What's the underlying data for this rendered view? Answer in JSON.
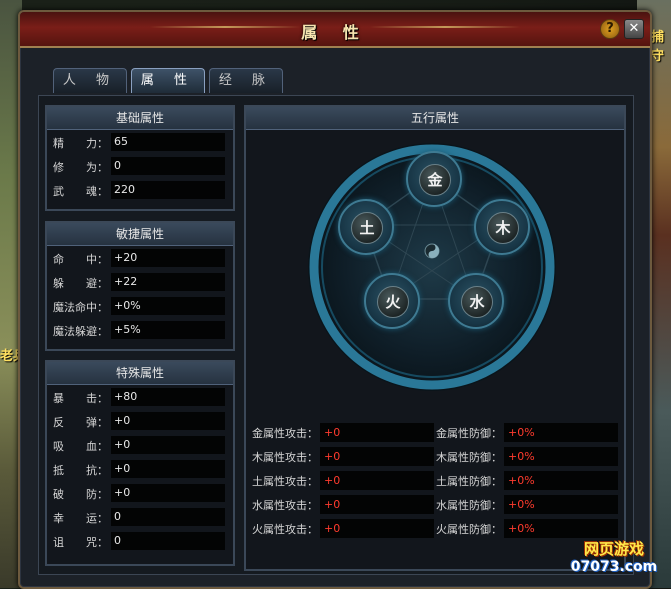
{
  "window": {
    "title": "属 性",
    "help_label": "?",
    "close_label": "✕"
  },
  "tabs": [
    {
      "label": "人 物",
      "active": false
    },
    {
      "label": "属 性",
      "active": true
    },
    {
      "label": "经 脉",
      "active": false
    }
  ],
  "basic": {
    "heading": "基础属性",
    "rows": [
      {
        "label": "精　　力：",
        "value": "65"
      },
      {
        "label": "修　　为：",
        "value": "0"
      },
      {
        "label": "武　　魂：",
        "value": "220"
      }
    ]
  },
  "agility": {
    "heading": "敏捷属性",
    "rows": [
      {
        "label": "命　　中：",
        "value": "+20"
      },
      {
        "label": "躲　　避：",
        "value": "+22"
      },
      {
        "label": "魔法命中：",
        "value": "+0%"
      },
      {
        "label": "魔法躲避：",
        "value": "+5%"
      }
    ]
  },
  "special": {
    "heading": "特殊属性",
    "rows": [
      {
        "label": "暴　　击：",
        "value": "+80"
      },
      {
        "label": "反　　弹：",
        "value": "+0"
      },
      {
        "label": "吸　　血：",
        "value": "+0"
      },
      {
        "label": "抵　　抗：",
        "value": "+0"
      },
      {
        "label": "破　　防：",
        "value": "+0"
      },
      {
        "label": "幸　　运：",
        "value": "0"
      },
      {
        "label": "诅　　咒：",
        "value": "0"
      }
    ]
  },
  "five_elements": {
    "heading": "五行属性",
    "nodes": [
      {
        "char": "金",
        "icon": "metal-element-icon"
      },
      {
        "char": "木",
        "icon": "wood-element-icon"
      },
      {
        "char": "水",
        "icon": "water-element-icon"
      },
      {
        "char": "火",
        "icon": "fire-element-icon"
      },
      {
        "char": "土",
        "icon": "earth-element-icon"
      }
    ],
    "stats": [
      {
        "atk_label": "金属性攻击：",
        "atk_value": "+0",
        "def_label": "金属性防御：",
        "def_value": "+0%"
      },
      {
        "atk_label": "木属性攻击：",
        "atk_value": "+0",
        "def_label": "木属性防御：",
        "def_value": "+0%"
      },
      {
        "atk_label": "土属性攻击：",
        "atk_value": "+0",
        "def_label": "土属性防御：",
        "def_value": "+0%"
      },
      {
        "atk_label": "水属性攻击：",
        "atk_value": "+0",
        "def_label": "水属性防御：",
        "def_value": "+0%"
      },
      {
        "atk_label": "火属性攻击：",
        "atk_value": "+0",
        "def_label": "火属性防御：",
        "def_value": "+0%"
      }
    ]
  },
  "background": {
    "npc_right": "捕守",
    "npc_left": "老兵"
  },
  "watermark": {
    "line1": "网页游戏",
    "line2": "07073.com"
  },
  "colors": {
    "title_bar": "#7a1e18",
    "stat_value_red": "#ff3b2e",
    "ring_blue": "#2a7898"
  }
}
